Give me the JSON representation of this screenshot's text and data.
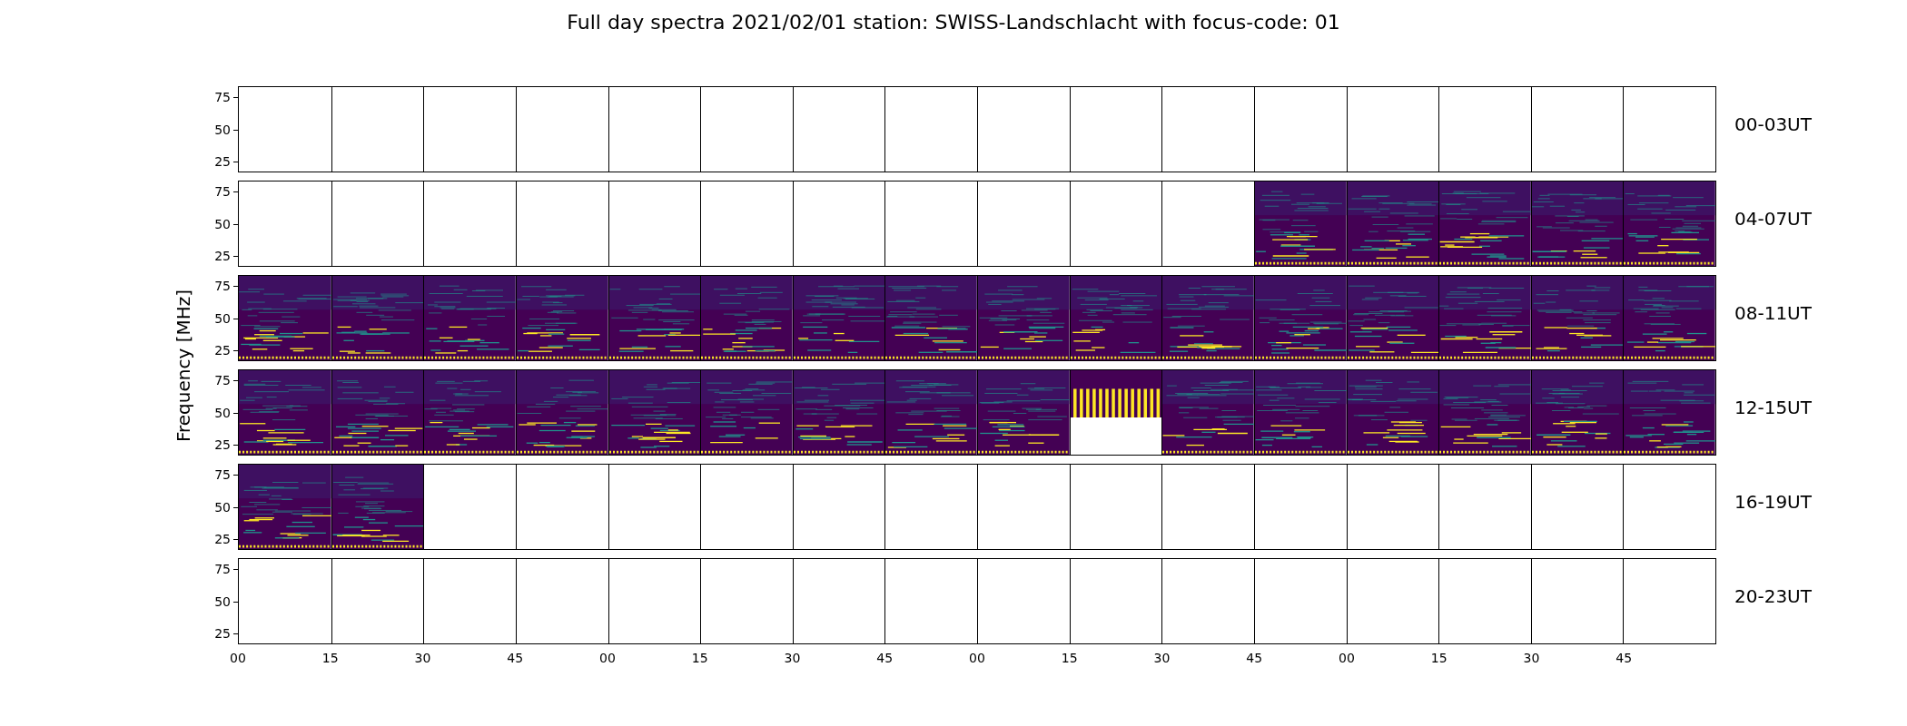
{
  "title": "Full day spectra 2021/02/01 station: SWISS-Landschlacht with focus-code: 01",
  "y_axis_label": "Frequency [MHz]",
  "rows": [
    {
      "label": "00-03UT",
      "y_ticks": [
        "75",
        "50",
        "25"
      ],
      "panels": [
        {
          "kind": "empty"
        },
        {
          "kind": "empty"
        },
        {
          "kind": "empty"
        },
        {
          "kind": "empty"
        },
        {
          "kind": "empty"
        },
        {
          "kind": "empty"
        },
        {
          "kind": "empty"
        },
        {
          "kind": "empty"
        },
        {
          "kind": "empty"
        },
        {
          "kind": "empty"
        },
        {
          "kind": "empty"
        },
        {
          "kind": "empty"
        },
        {
          "kind": "empty"
        },
        {
          "kind": "empty"
        },
        {
          "kind": "empty"
        },
        {
          "kind": "empty"
        }
      ]
    },
    {
      "label": "04-07UT",
      "y_ticks": [
        "75",
        "50",
        "25"
      ],
      "panels": [
        {
          "kind": "empty"
        },
        {
          "kind": "empty"
        },
        {
          "kind": "empty"
        },
        {
          "kind": "empty"
        },
        {
          "kind": "empty"
        },
        {
          "kind": "empty"
        },
        {
          "kind": "empty"
        },
        {
          "kind": "empty"
        },
        {
          "kind": "empty"
        },
        {
          "kind": "empty"
        },
        {
          "kind": "empty"
        },
        {
          "kind": "spectrum"
        },
        {
          "kind": "spectrum"
        },
        {
          "kind": "spectrum"
        },
        {
          "kind": "spectrum"
        },
        {
          "kind": "spectrum"
        }
      ]
    },
    {
      "label": "08-11UT",
      "y_ticks": [
        "75",
        "50",
        "25"
      ],
      "panels": [
        {
          "kind": "spectrum"
        },
        {
          "kind": "spectrum"
        },
        {
          "kind": "spectrum"
        },
        {
          "kind": "spectrum"
        },
        {
          "kind": "spectrum"
        },
        {
          "kind": "spectrum"
        },
        {
          "kind": "spectrum"
        },
        {
          "kind": "spectrum"
        },
        {
          "kind": "spectrum"
        },
        {
          "kind": "spectrum"
        },
        {
          "kind": "spectrum"
        },
        {
          "kind": "spectrum"
        },
        {
          "kind": "spectrum"
        },
        {
          "kind": "spectrum"
        },
        {
          "kind": "spectrum"
        },
        {
          "kind": "spectrum"
        }
      ]
    },
    {
      "label": "12-15UT",
      "y_ticks": [
        "75",
        "50",
        "25"
      ],
      "panels": [
        {
          "kind": "spectrum"
        },
        {
          "kind": "spectrum"
        },
        {
          "kind": "spectrum"
        },
        {
          "kind": "spectrum"
        },
        {
          "kind": "spectrum"
        },
        {
          "kind": "spectrum"
        },
        {
          "kind": "spectrum"
        },
        {
          "kind": "spectrum"
        },
        {
          "kind": "spectrum"
        },
        {
          "kind": "gap"
        },
        {
          "kind": "spectrum"
        },
        {
          "kind": "spectrum"
        },
        {
          "kind": "spectrum"
        },
        {
          "kind": "spectrum"
        },
        {
          "kind": "spectrum"
        },
        {
          "kind": "spectrum"
        }
      ]
    },
    {
      "label": "16-19UT",
      "y_ticks": [
        "75",
        "50",
        "25"
      ],
      "panels": [
        {
          "kind": "spectrum"
        },
        {
          "kind": "spectrum"
        },
        {
          "kind": "empty"
        },
        {
          "kind": "empty"
        },
        {
          "kind": "empty"
        },
        {
          "kind": "empty"
        },
        {
          "kind": "empty"
        },
        {
          "kind": "empty"
        },
        {
          "kind": "empty"
        },
        {
          "kind": "empty"
        },
        {
          "kind": "empty"
        },
        {
          "kind": "empty"
        },
        {
          "kind": "empty"
        },
        {
          "kind": "empty"
        },
        {
          "kind": "empty"
        },
        {
          "kind": "empty"
        }
      ]
    },
    {
      "label": "20-23UT",
      "y_ticks": [
        "75",
        "50",
        "25"
      ],
      "panels": [
        {
          "kind": "empty"
        },
        {
          "kind": "empty"
        },
        {
          "kind": "empty"
        },
        {
          "kind": "empty"
        },
        {
          "kind": "empty"
        },
        {
          "kind": "empty"
        },
        {
          "kind": "empty"
        },
        {
          "kind": "empty"
        },
        {
          "kind": "empty"
        },
        {
          "kind": "empty"
        },
        {
          "kind": "empty"
        },
        {
          "kind": "empty"
        },
        {
          "kind": "empty"
        },
        {
          "kind": "empty"
        },
        {
          "kind": "empty"
        },
        {
          "kind": "empty"
        }
      ]
    }
  ],
  "x_ticks": [
    "00",
    "15",
    "30",
    "45",
    "00",
    "15",
    "30",
    "45",
    "00",
    "15",
    "30",
    "45",
    "00",
    "15",
    "30",
    "45"
  ]
}
